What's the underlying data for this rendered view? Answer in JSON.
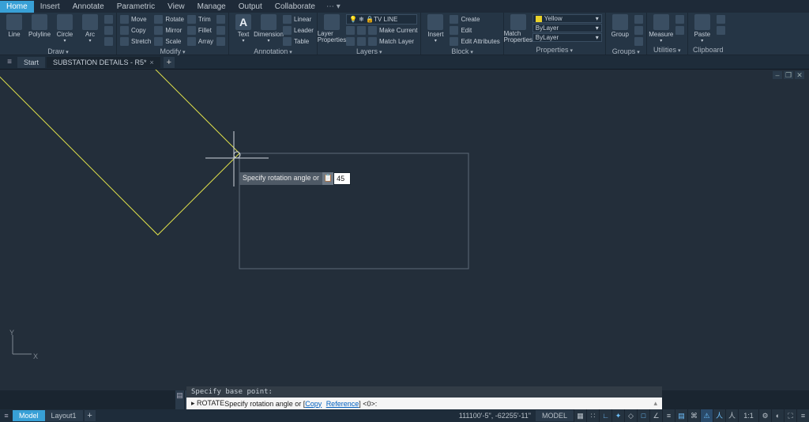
{
  "menu": {
    "tabs": [
      "Home",
      "Insert",
      "Annotate",
      "Parametric",
      "View",
      "Manage",
      "Output",
      "Collaborate"
    ],
    "active": 0,
    "share": "⋯ ▾"
  },
  "ribbon": {
    "draw": {
      "label": "Draw",
      "line": "Line",
      "polyline": "Polyline",
      "circle": "Circle",
      "arc": "Arc"
    },
    "modify": {
      "label": "Modify",
      "r0": [
        "Move",
        "Rotate",
        "Trim"
      ],
      "r1": [
        "Copy",
        "Mirror",
        "Fillet"
      ],
      "r2": [
        "Stretch",
        "Scale",
        "Array"
      ]
    },
    "annot": {
      "label": "Annotation",
      "text": "Text",
      "dim": "Dimension",
      "r0": "Linear",
      "r1": "Leader",
      "r2": "Table"
    },
    "layers": {
      "label": "Layers",
      "prop": "Layer\nProperties",
      "combo": "TV LINE",
      "r1": "Make Current",
      "r2": "Match Layer"
    },
    "block": {
      "label": "Block",
      "ins": "Insert",
      "r0": "Create",
      "r1": "Edit",
      "r2": "Edit Attributes"
    },
    "props": {
      "label": "Properties",
      "match": "Match\nProperties",
      "color": "Yellow",
      "lw": "ByLayer",
      "lt": "ByLayer"
    },
    "groups": {
      "label": "Groups",
      "g": "Group"
    },
    "utils": {
      "label": "Utilities",
      "m": "Measure"
    },
    "clip": {
      "label": "Clipboard",
      "p": "Paste"
    }
  },
  "docs": {
    "start": "Start",
    "active": "SUBSTATION DETAILS - R5*"
  },
  "dyn": {
    "label": "Specify rotation angle or",
    "btn": "📋",
    "value": "45"
  },
  "cmd": {
    "hist": "Specify base point:",
    "prefix": "▸ ROTATE ",
    "text": "Specify rotation angle or [",
    "opt1": "Copy",
    "opt2": "Reference",
    "suffix": "] <0>:"
  },
  "status": {
    "model": "Model",
    "layout": "Layout1",
    "coords": "111100'-5\", -62255'-11\"",
    "mode": "MODEL",
    "scale": "1:1"
  },
  "ucs": {
    "x": "X",
    "y": "Y"
  },
  "chart_data": {
    "type": "vector-drawing",
    "objects": [
      {
        "shape": "rectangle-rotated",
        "color": "#dfe04a",
        "approx_angle_deg": 45,
        "note": "original selection, ghosted preview near center"
      },
      {
        "shape": "rectangle",
        "color": "#6a7582",
        "note": "ghost/original position"
      }
    ],
    "command": "ROTATE",
    "prompt": "Specify rotation angle or [Copy Reference] <0>:",
    "input_value": 45
  }
}
